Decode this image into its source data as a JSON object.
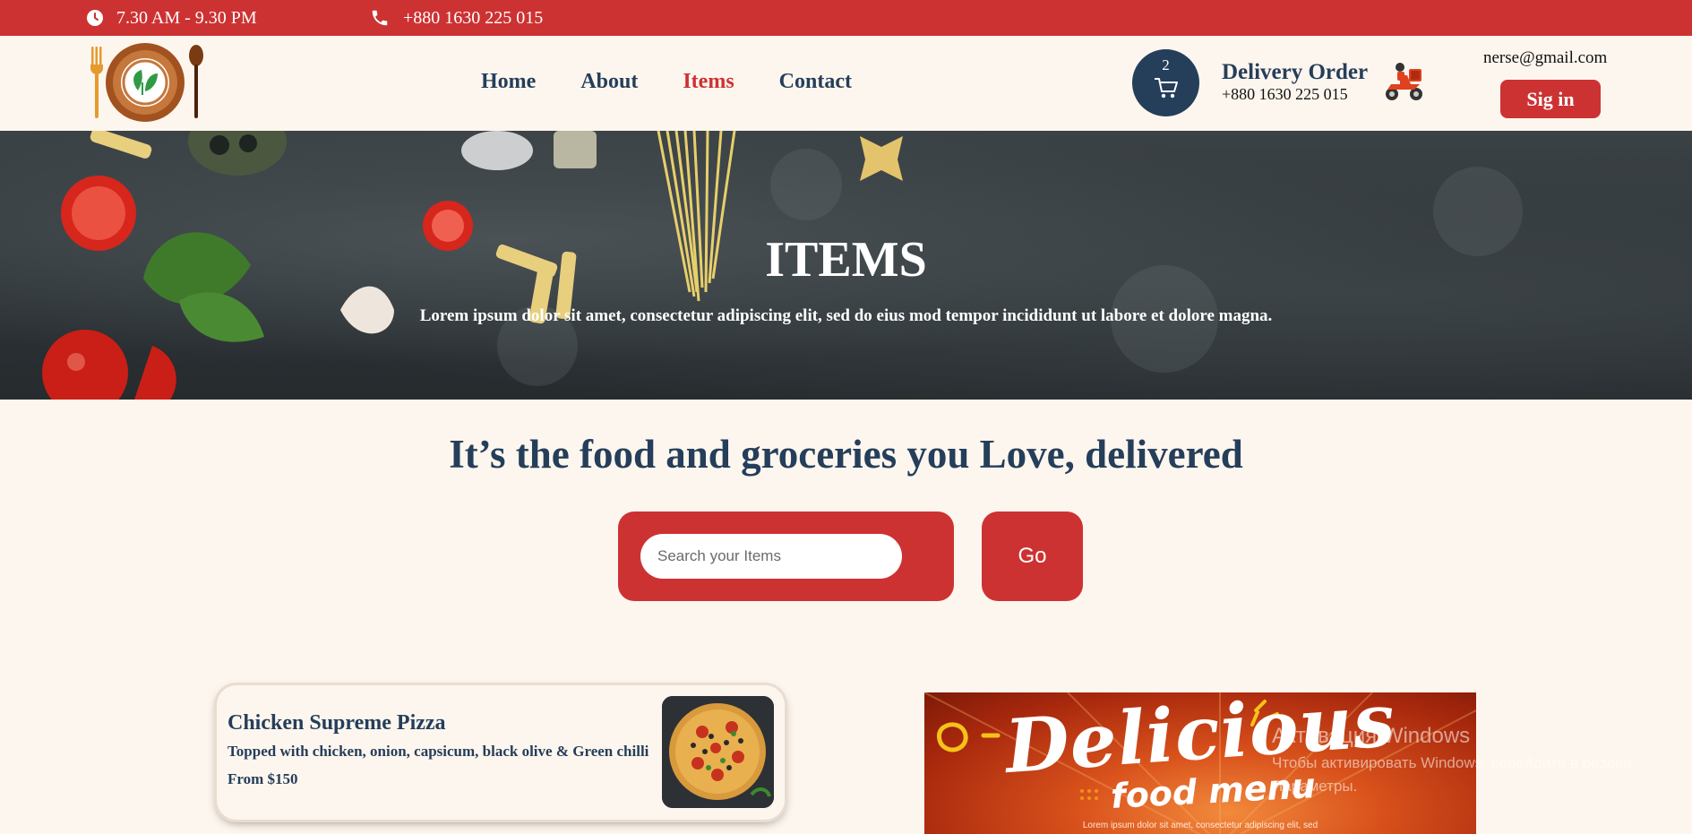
{
  "topbar": {
    "hours": "7.30 AM - 9.30 PM",
    "phone": "+880 1630 225 015",
    "icons": [
      "clock-icon",
      "phone-icon"
    ]
  },
  "header": {
    "nav": [
      "Home",
      "About",
      "Items",
      "Contact"
    ],
    "active_nav": "Items",
    "cart_count": "2",
    "delivery_title": "Delivery Order",
    "delivery_phone": "+880 1630 225 015",
    "email": "nerse@gmail.com",
    "signin_label": "Sig in"
  },
  "hero": {
    "title": "ITEMS",
    "subtitle": "Lorem ipsum dolor sit amet, consectetur adipiscing elit, sed do eius mod tempor incididunt ut labore et dolore magna."
  },
  "main": {
    "tagline": "It’s the food and groceries you Love, delivered",
    "search_placeholder": "Search your Items",
    "search_value": "",
    "go_label": "Go"
  },
  "items": [
    {
      "name": "Chicken Supreme Pizza",
      "description": "Topped with chicken, onion, capsicum, black olive & Green chilli",
      "price": "From $150"
    }
  ],
  "banner": {
    "headline": "Delicious",
    "subline": "food menu",
    "caption": "Lorem ipsum dolor sit amet, consectetur adipiscing elit, sed"
  },
  "watermark": {
    "line1": "Активация Windows",
    "line2": "Чтобы активировать Windows, перейдите в раздел",
    "line3": "Параметры."
  },
  "colors": {
    "brand_red": "#cd3233",
    "navy": "#253e5a",
    "cream": "#fdf6ee"
  }
}
